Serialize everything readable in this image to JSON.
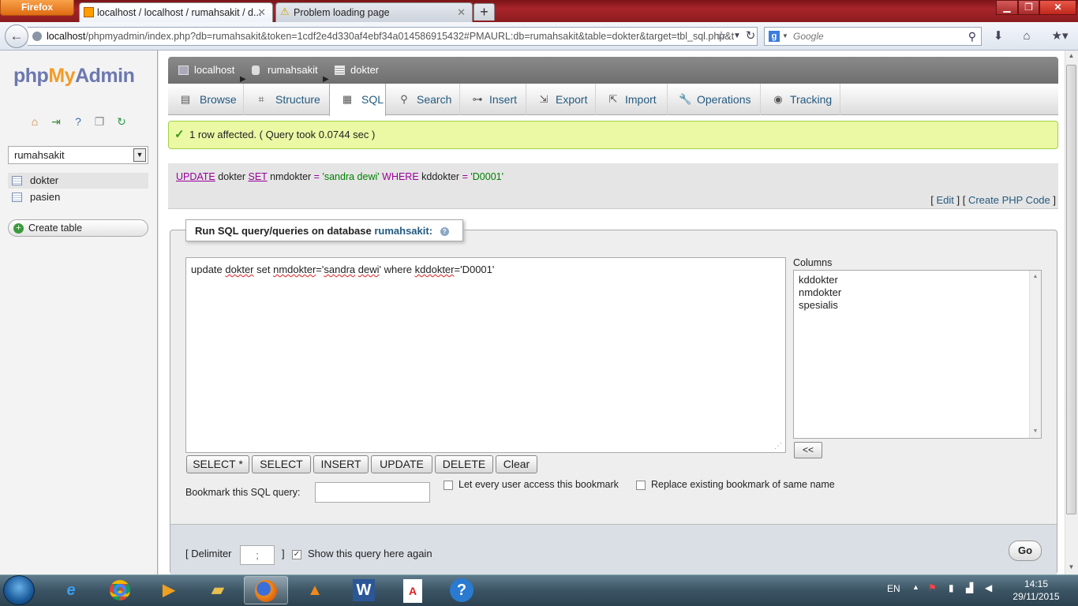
{
  "browser": {
    "menu_button": "Firefox",
    "tabs": [
      {
        "title": "localhost / localhost / rumahsakit / d..."
      },
      {
        "title": "Problem loading page"
      }
    ],
    "new_tab": "+",
    "url_host": "localhost",
    "url_path": "/phpmyadmin/index.php?db=rumahsakit&token=1cdf2e4d330af4ebf34a014586915432#PMAURL:db=rumahsakit&table=dokter&target=tbl_sql.php&t",
    "search_placeholder": "Google"
  },
  "sidebar": {
    "logo_php": "php",
    "logo_my": "My",
    "logo_admin": "Admin",
    "database_select": "rumahsakit",
    "tables": [
      {
        "name": "dokter"
      },
      {
        "name": "pasien"
      }
    ],
    "create_table": "Create table"
  },
  "breadcrumb": {
    "server": "localhost",
    "database": "rumahsakit",
    "table": "dokter"
  },
  "tabs": [
    {
      "label": "Browse",
      "icon": "browse-icon"
    },
    {
      "label": "Structure",
      "icon": "structure-icon"
    },
    {
      "label": "SQL",
      "icon": "sql-icon"
    },
    {
      "label": "Search",
      "icon": "search-icon"
    },
    {
      "label": "Insert",
      "icon": "insert-icon"
    },
    {
      "label": "Export",
      "icon": "export-icon"
    },
    {
      "label": "Import",
      "icon": "import-icon"
    },
    {
      "label": "Operations",
      "icon": "wrench-icon"
    },
    {
      "label": "Tracking",
      "icon": "eye-icon"
    }
  ],
  "active_tab": "SQL",
  "success_message": "1 row affected. ( Query took 0.0744 sec )",
  "executed_query": {
    "kw_update": "UPDATE",
    "table": "dokter",
    "kw_set": "SET",
    "col": "nmdokter",
    "eq1": "=",
    "val1": "'sandra dewi'",
    "kw_where": "WHERE",
    "col2": "kddokter",
    "eq2": "=",
    "val2": "'D0001'"
  },
  "query_links": {
    "edit": "Edit",
    "create_php": "Create PHP Code"
  },
  "sql_panel": {
    "legend_prefix": "Run SQL query/queries on database",
    "database": "rumahsakit:",
    "query_text": {
      "p1": "update ",
      "p2": "dokter",
      "p3": " set ",
      "p4": "nmdokter",
      "p5": "='",
      "p6": "sandra",
      "p7": " ",
      "p8": "dewi",
      "p9": "' where ",
      "p10": "kddokter",
      "p11": "='D0001'"
    },
    "columns_label": "Columns",
    "columns": [
      "kddokter",
      "nmdokter",
      "spesialis"
    ],
    "insert_columns_button": "<<",
    "buttons": [
      "SELECT *",
      "SELECT",
      "INSERT",
      "UPDATE",
      "DELETE",
      "Clear"
    ],
    "bookmark_label": "Bookmark this SQL query:",
    "let_every_user": "Let every user access this bookmark",
    "replace_existing": "Replace existing bookmark of same name",
    "delimiter_label": "[ Delimiter",
    "delimiter_value": ";",
    "delimiter_close": "]",
    "show_again": "Show this query here again",
    "show_again_checked": true,
    "go": "Go"
  },
  "taskbar": {
    "language": "EN",
    "time": "14:15",
    "date": "29/11/2015"
  },
  "colors": {
    "success_bg": "#ebf8a4",
    "link": "#235a81",
    "keyword": "#990099",
    "string": "#008000"
  }
}
